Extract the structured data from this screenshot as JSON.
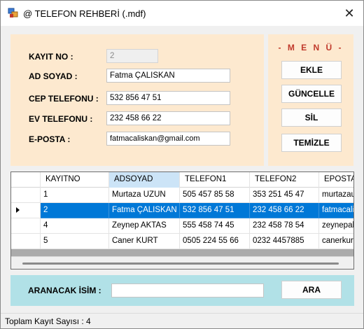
{
  "window": {
    "title": "@ TELEFON REHBERİ (.mdf)",
    "close_glyph": "✕"
  },
  "form": {
    "kayit_no_label": "KAYIT NO :",
    "kayit_no_value": "2",
    "ad_soyad_label": "AD SOYAD :",
    "ad_soyad_value": "Fatma ÇALISKAN",
    "cep_label": "CEP TELEFONU :",
    "cep_value": "532 856 47 51",
    "ev_label": "EV TELEFONU :",
    "ev_value": "232 458 66 22",
    "eposta_label": "E-POSTA :",
    "eposta_value": "fatmacaliskan@gmail.com"
  },
  "menu": {
    "title": "- M E N Ü -",
    "ekle": "EKLE",
    "guncelle": "GÜNCELLE",
    "sil": "SİL",
    "temizle": "TEMİZLE"
  },
  "grid": {
    "columns": [
      "KAYITNO",
      "ADSOYAD",
      "TELEFON1",
      "TELEFON2",
      "EPOSTA"
    ],
    "rows": [
      [
        "1",
        "Murtaza UZUN",
        "505 457 85 58",
        "353 251 45 47",
        "murtazauzun@gmail.com"
      ],
      [
        "2",
        "Fatma ÇALISKAN",
        "532 856 47 51",
        "232 458 66 22",
        "fatmacaliskan@gmail.com"
      ],
      [
        "4",
        "Zeynep AKTAS",
        "555 458 74 45",
        "232 458 78 54",
        "zeynepaktas@gmail.com"
      ],
      [
        "5",
        "Caner KURT",
        "0505 224 55 66",
        "0232 4457885",
        "canerkurt@gmail.com"
      ]
    ],
    "selected_row_index": 1,
    "selected_column": "ADSOYAD"
  },
  "search": {
    "label": "ARANACAK  İSİM :",
    "value": "",
    "button": "ARA"
  },
  "status": {
    "text": "Toplam Kayıt Sayısı : 4"
  },
  "colors": {
    "form_panel": "#fde9cf",
    "search_panel": "#b1e1e7",
    "selection": "#0078d7",
    "menu_title": "#c0392b"
  }
}
